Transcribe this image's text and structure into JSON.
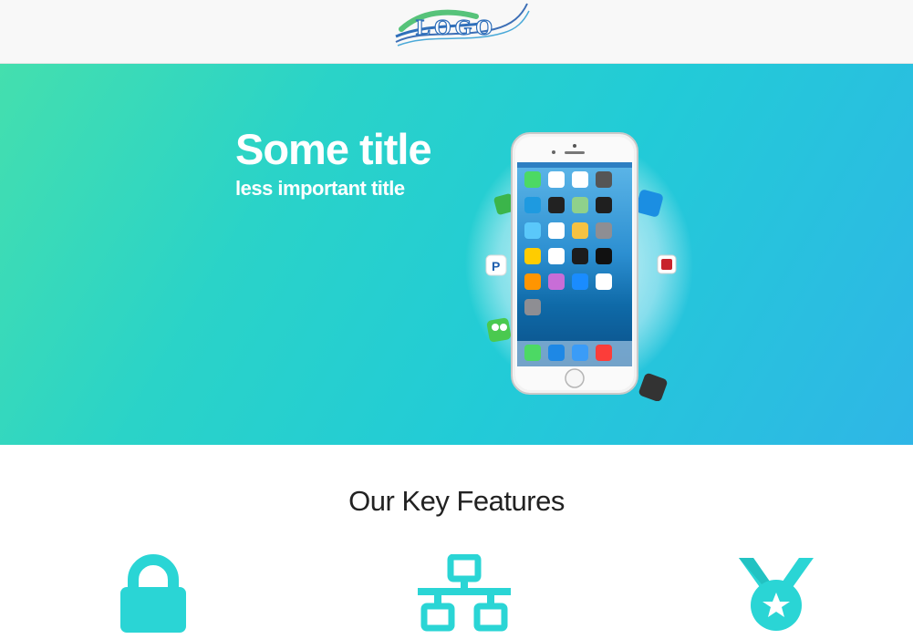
{
  "header": {
    "logo_text": "LOGO",
    "logo_icon": "swoosh-logo"
  },
  "hero": {
    "title": "Some title",
    "subtitle": "less important title",
    "image": "smartphone-with-app-icons"
  },
  "features": {
    "title": "Our Key Features",
    "items": [
      {
        "icon": "lock-icon"
      },
      {
        "icon": "network-icon"
      },
      {
        "icon": "medal-icon"
      }
    ]
  },
  "colors": {
    "header_bg": "#f8f8f8",
    "hero_gradient_start": "#44dfae",
    "hero_gradient_end": "#2fb6e6",
    "feature_icon": "#2ad5d5",
    "heading_text": "#222222"
  }
}
